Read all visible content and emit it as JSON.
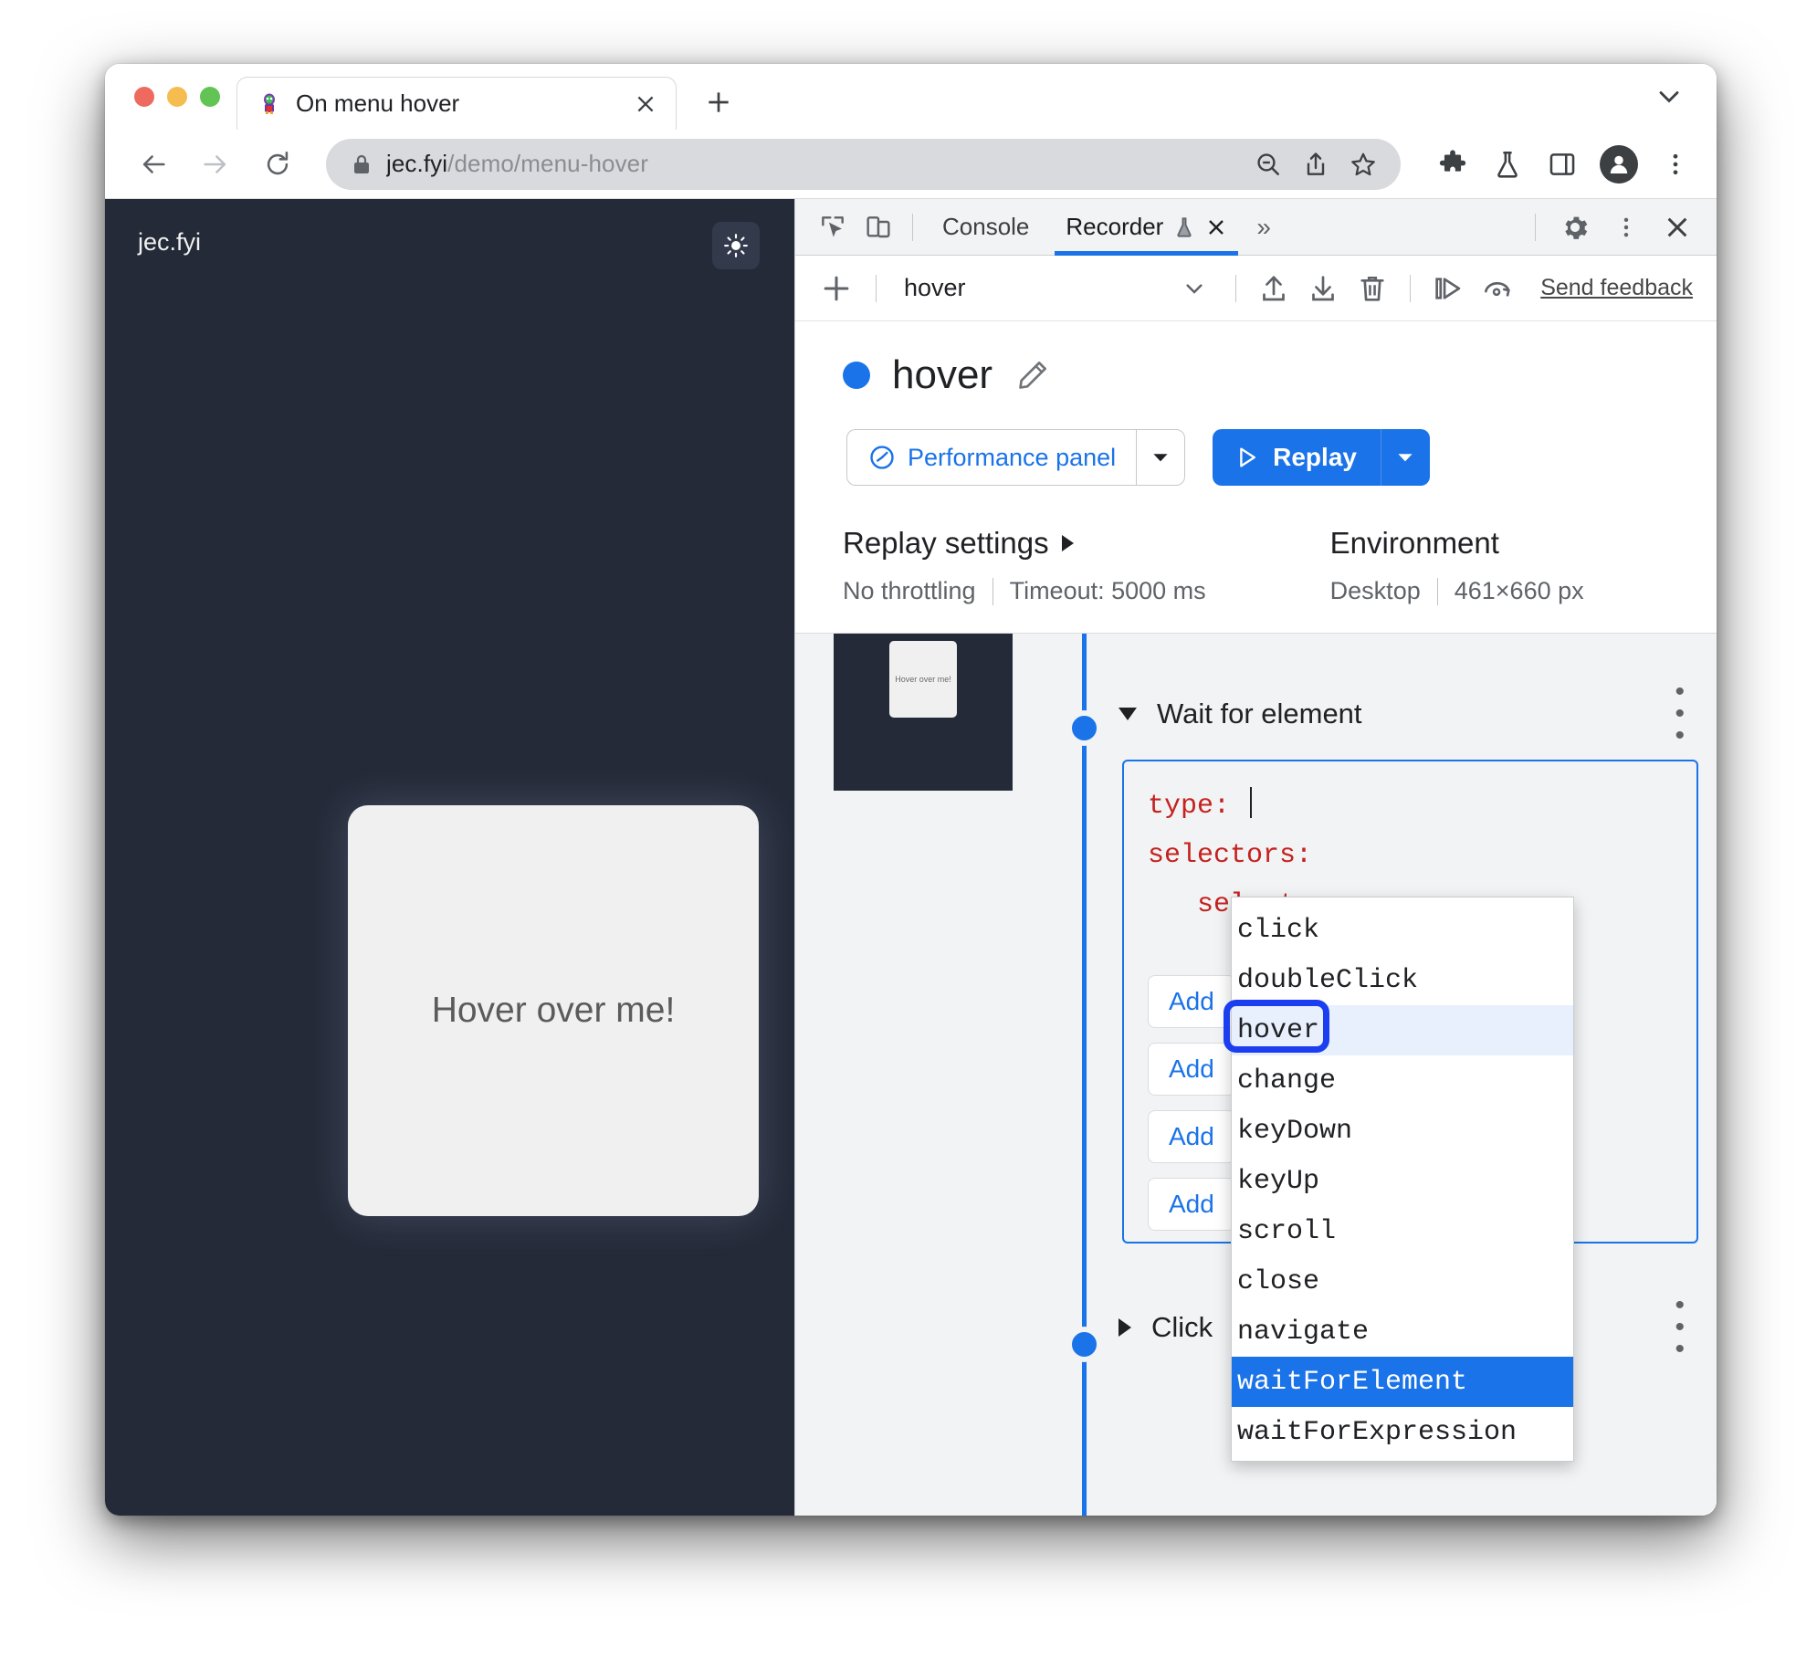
{
  "browser": {
    "tab": {
      "title": "On menu hover",
      "favicon_name": "site-favicon",
      "close_label": "×"
    },
    "new_tab_label": "+",
    "tabstrip_menu_icon": "chevron-down-icon",
    "nav": {
      "back_icon": "back-arrow-icon",
      "forward_icon": "forward-arrow-icon",
      "reload_icon": "reload-icon"
    },
    "omnibox": {
      "lock_icon": "lock-icon",
      "url_domain": "jec.fyi",
      "url_path": "/demo/menu-hover",
      "zoom_out_icon": "zoom-out-icon",
      "share_icon": "share-icon",
      "bookmark_icon": "star-icon"
    },
    "toolbar": {
      "extensions_icon": "puzzle-icon",
      "labs_icon": "flask-icon",
      "sidepanel_icon": "side-panel-icon",
      "profile_icon": "account-avatar-icon",
      "menu_icon": "three-dot-menu-icon"
    }
  },
  "page": {
    "brand": "jec.fyi",
    "theme_toggle_icon": "sun-icon",
    "card_text": "Hover over me!"
  },
  "devtools": {
    "tabbar": {
      "inspect_icon": "inspect-element-icon",
      "device_icon": "device-toolbar-icon",
      "tabs": [
        {
          "label": "Console",
          "active": false
        },
        {
          "label": "Recorder",
          "active": true,
          "experiment_icon": "flask-icon",
          "close_label": "×"
        }
      ],
      "overflow_label": "»",
      "settings_icon": "gear-icon",
      "more_icon": "three-dot-menu-icon",
      "close_icon": "close-icon"
    },
    "recorder_toolbar": {
      "add_icon": "plus-icon",
      "recording_name": "hover",
      "dropdown_icon": "chevron-down-icon",
      "import_icon": "upload-icon",
      "export_icon": "download-icon",
      "delete_icon": "trash-icon",
      "step_icon": "step-over-icon",
      "replay_speed_icon": "replay-speed-icon",
      "feedback_label": "Send feedback"
    },
    "recording": {
      "status_dot_color": "#1a73e8",
      "title": "hover",
      "edit_icon": "pencil-icon",
      "perf_button": {
        "label": "Performance panel",
        "icon": "performance-gauge-icon",
        "caret_icon": "caret-down-icon"
      },
      "replay_button": {
        "label": "Replay",
        "icon": "play-triangle-icon",
        "caret_icon": "caret-down-icon"
      }
    },
    "settings": {
      "replay": {
        "heading": "Replay settings",
        "expand_icon": "caret-right-icon",
        "throttling": "No throttling",
        "timeout": "Timeout: 5000 ms"
      },
      "environment": {
        "heading": "Environment",
        "device": "Desktop",
        "viewport": "461×660 px"
      }
    },
    "steps": [
      {
        "label": "Wait for element",
        "expanded": true,
        "menu_icon": "three-dot-menu-icon",
        "thumbnail_text": "Hover over me!"
      },
      {
        "label": "Click",
        "expanded": false,
        "menu_icon": "three-dot-menu-icon"
      }
    ],
    "step_editor": {
      "lines": [
        {
          "key": "type:",
          "value": "",
          "indent": 0,
          "caret": true
        },
        {
          "key": "selectors:",
          "value": "",
          "indent": 0,
          "caret": false
        },
        {
          "key": "selector:",
          "value": "",
          "indent": 1,
          "caret": false
        }
      ],
      "add_buttons": [
        "Add",
        "Add",
        "Add",
        "Add"
      ]
    },
    "autocomplete": {
      "items": [
        {
          "label": "click",
          "state": "normal"
        },
        {
          "label": "doubleClick",
          "state": "normal"
        },
        {
          "label": "hover",
          "state": "hovered"
        },
        {
          "label": "change",
          "state": "normal"
        },
        {
          "label": "keyDown",
          "state": "normal"
        },
        {
          "label": "keyUp",
          "state": "normal"
        },
        {
          "label": "scroll",
          "state": "normal"
        },
        {
          "label": "close",
          "state": "normal"
        },
        {
          "label": "navigate",
          "state": "normal"
        },
        {
          "label": "waitForElement",
          "state": "selected"
        },
        {
          "label": "waitForExpression",
          "state": "normal"
        }
      ],
      "annotation_target": "hover",
      "annotation_color": "#1b3ff0"
    }
  }
}
